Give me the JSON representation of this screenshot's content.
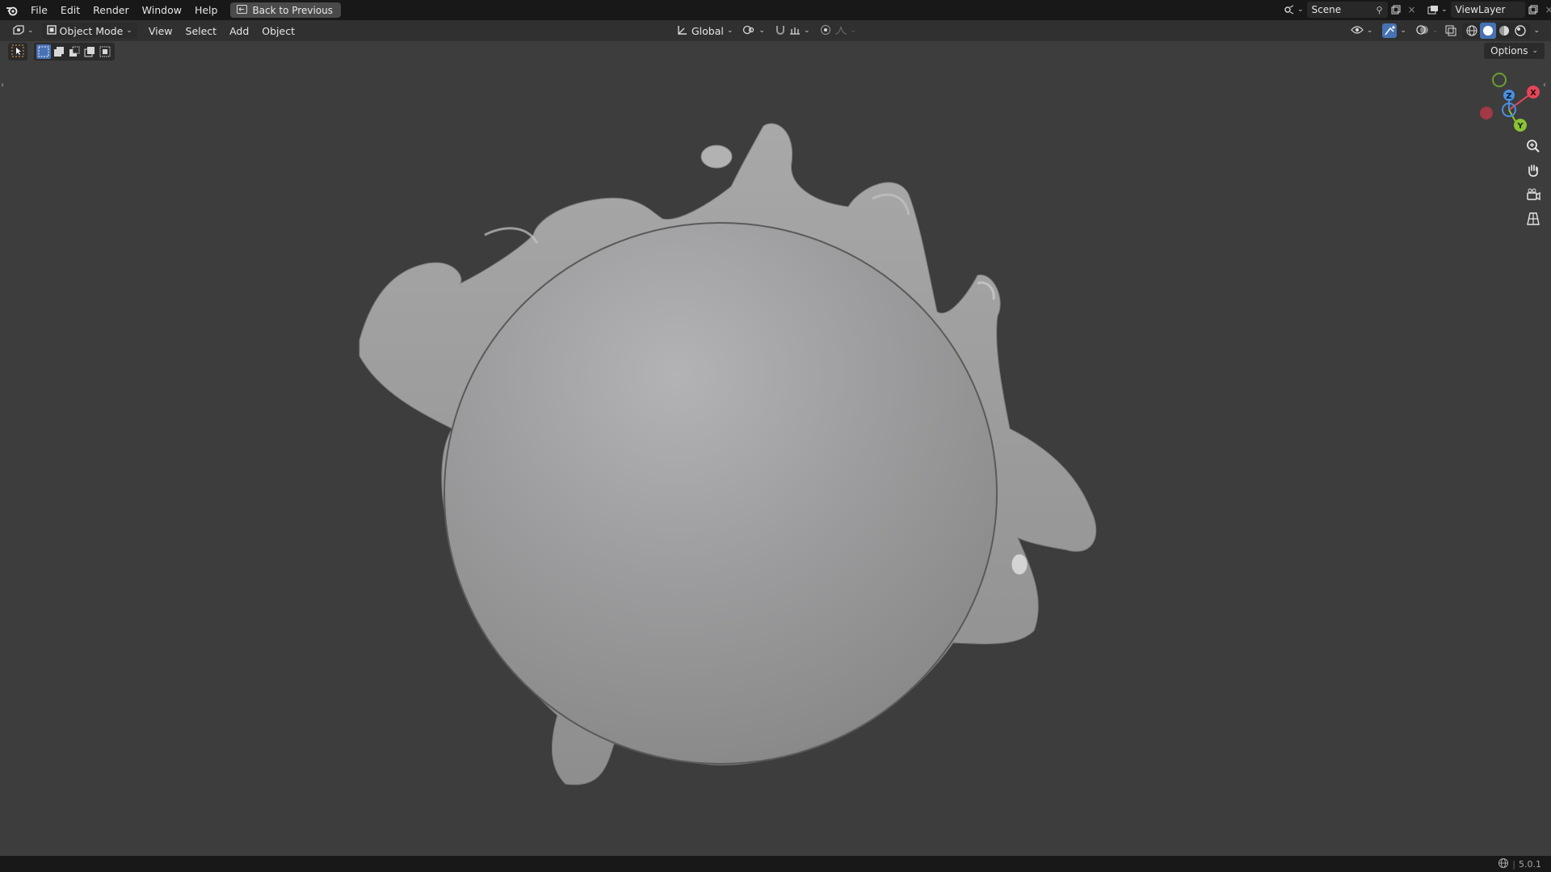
{
  "topbar": {
    "menus": [
      "File",
      "Edit",
      "Render",
      "Window",
      "Help"
    ],
    "back_button": "Back to Previous",
    "scene_label": "Scene",
    "view_layer_label": "ViewLayer"
  },
  "header": {
    "mode": "Object Mode",
    "menus": [
      "View",
      "Select",
      "Add",
      "Object"
    ],
    "transform_orientation": "Global"
  },
  "viewport": {
    "options_label": "Options",
    "gizmo_axes": [
      "X",
      "Y",
      "Z"
    ],
    "axis_colors": {
      "x": "#e6465a",
      "y": "#8bc334",
      "z": "#4a8fe0"
    }
  },
  "status": {
    "version": "5.0.1"
  },
  "icons": [
    "blender-logo-icon",
    "back-icon",
    "scene-icon",
    "pin-icon",
    "copy-icon",
    "close-icon",
    "editor-type-icon",
    "object-mode-icon",
    "orientation-icon",
    "pivot-icon",
    "snap-icon",
    "proportional-icon",
    "visibility-icon",
    "gizmo-icon",
    "overlay-icon",
    "xray-icon",
    "wireframe-icon",
    "solid-icon",
    "material-icon",
    "rendered-icon",
    "zoom-icon",
    "pan-icon",
    "camera-icon",
    "grid-icon",
    "network-icon"
  ],
  "colors": {
    "accent": "#4772b3",
    "background": "#3d3d3d",
    "mesh": "#9a9a9a"
  }
}
